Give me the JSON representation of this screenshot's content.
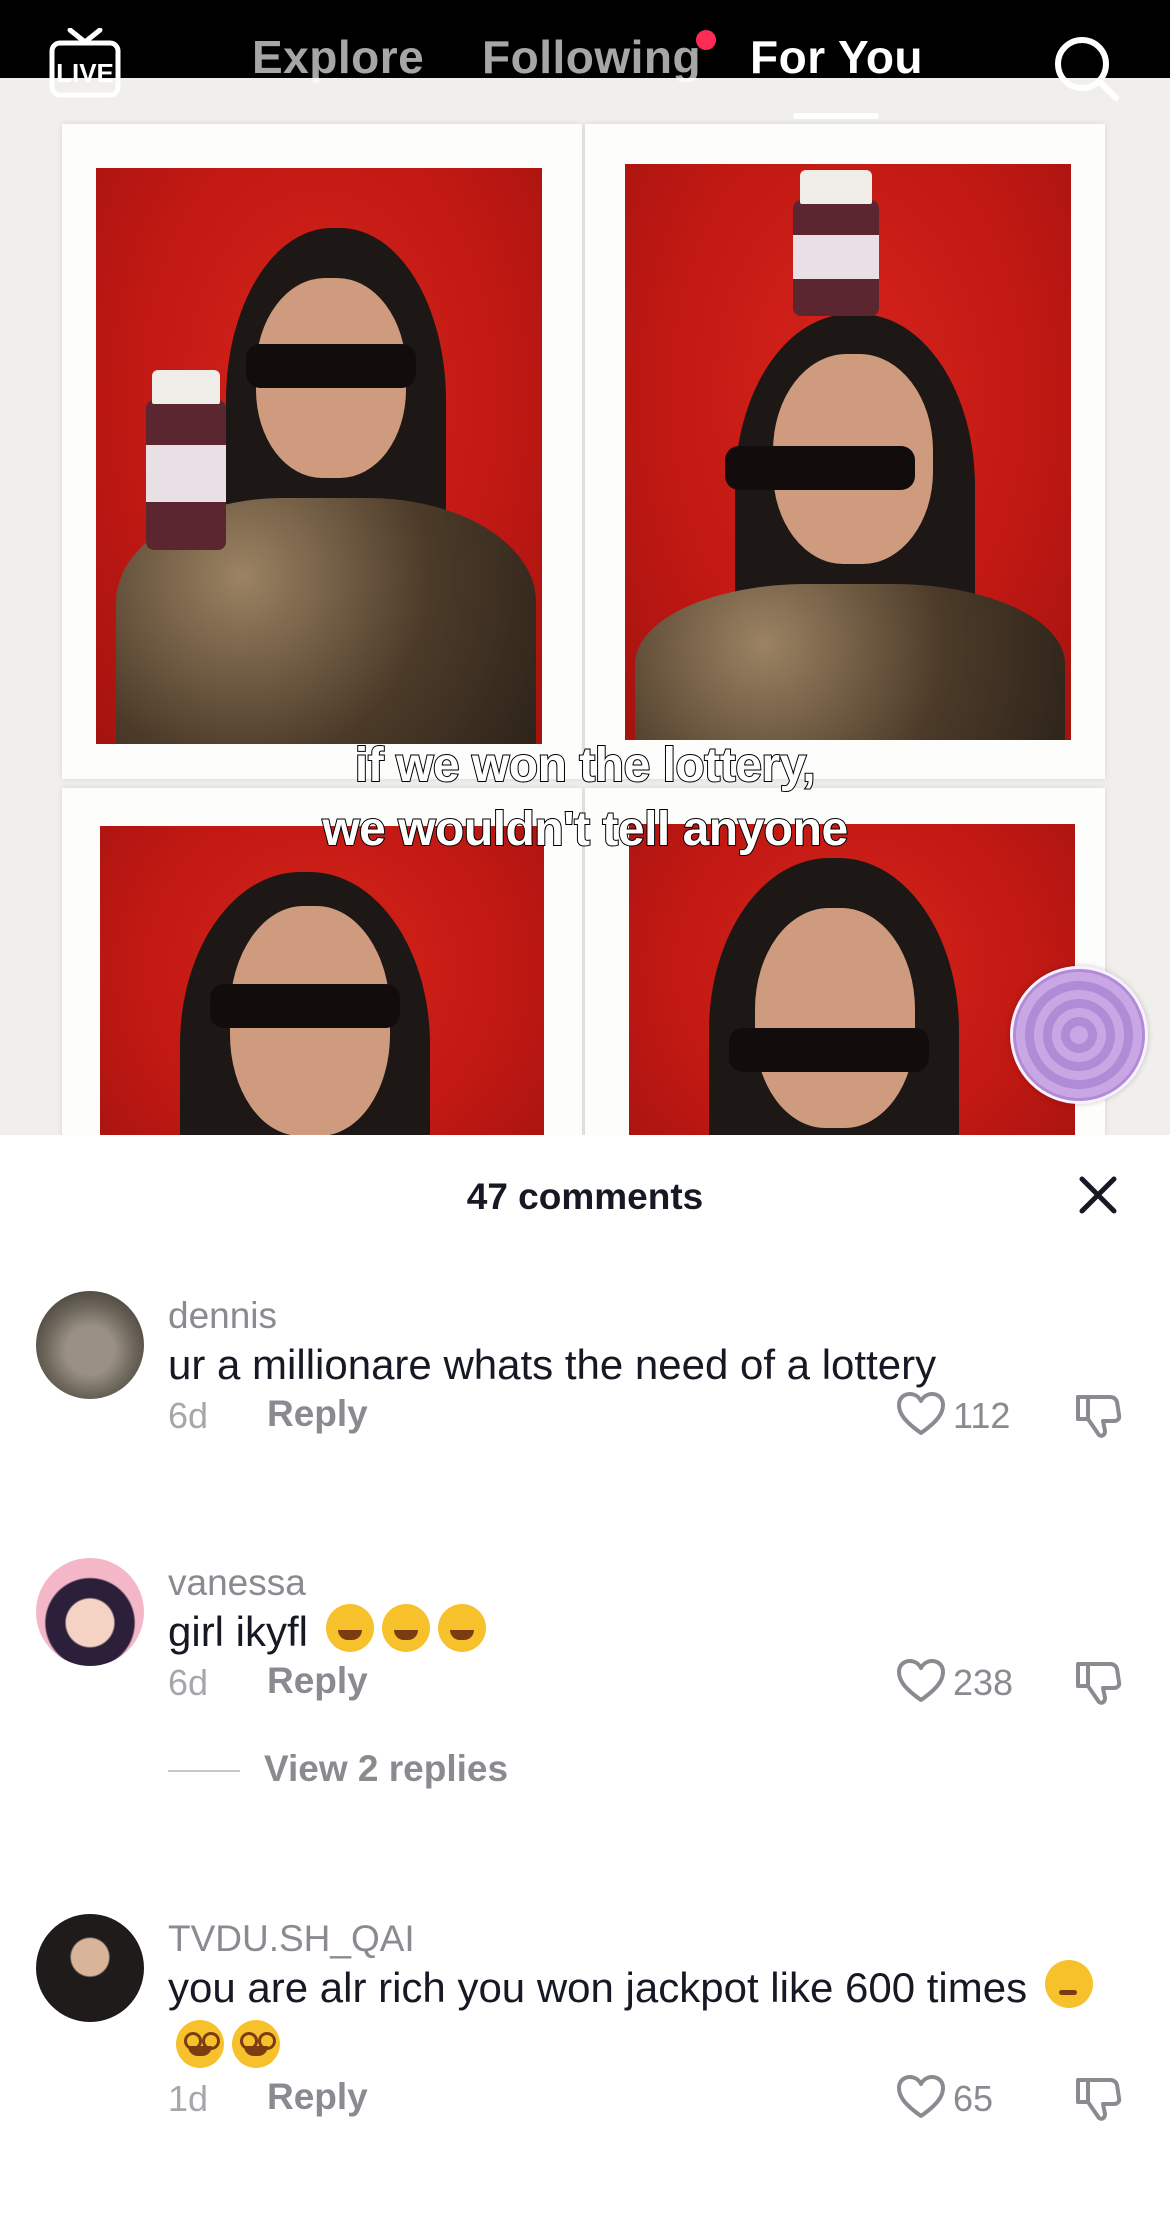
{
  "topnav": {
    "live_label": "LIVE",
    "tabs": [
      {
        "label": "Explore",
        "active": false
      },
      {
        "label": "Following",
        "active": false,
        "has_notification_dot": true
      },
      {
        "label": "For You",
        "active": true
      }
    ]
  },
  "video": {
    "caption_line_1": "if we won the lottery,",
    "caption_line_2": "we wouldn't tell anyone"
  },
  "comments_sheet": {
    "count_label": "47 comments",
    "comments": [
      {
        "username": "dennis",
        "text": "ur a millionare whats the need of a lottery",
        "emojis": [],
        "age": "6d",
        "reply_label": "Reply",
        "likes": "112"
      },
      {
        "username": "vanessa",
        "text": "girl ikyfl",
        "emojis": [
          "rolling-on-floor-laughing",
          "rolling-on-floor-laughing",
          "rolling-on-floor-laughing"
        ],
        "age": "6d",
        "reply_label": "Reply",
        "likes": "238",
        "view_replies_label": "View 2 replies"
      },
      {
        "username": "TVDU.SH_QAI",
        "text": "you are alr rich you won jackpot like 600 times",
        "emojis": [
          "thinking-face",
          "face-with-spiral-eyes",
          "face-with-spiral-eyes"
        ],
        "age": "1d",
        "reply_label": "Reply",
        "likes": "65"
      }
    ]
  },
  "colors": {
    "nav_background": "#000000",
    "notification_dot": "#fe2c55",
    "text_primary": "#161823",
    "text_secondary": "#8a8b91",
    "photo_backdrop": "#c01813"
  }
}
